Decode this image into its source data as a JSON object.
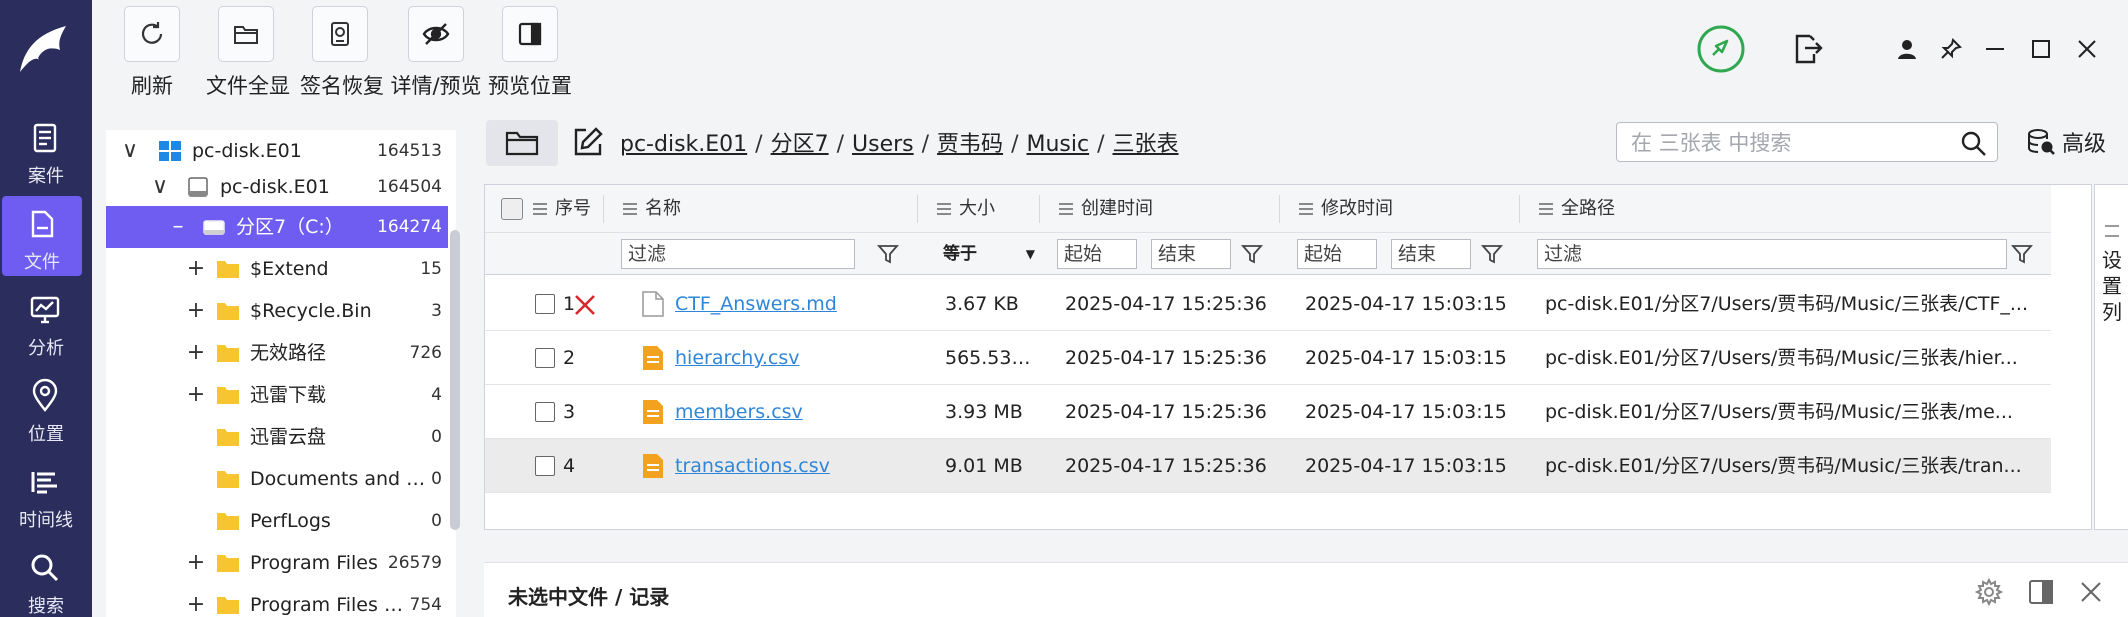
{
  "nav": {
    "items": [
      {
        "label": "案件",
        "icon": "case-icon"
      },
      {
        "label": "文件",
        "icon": "file-icon"
      },
      {
        "label": "分析",
        "icon": "analysis-icon"
      },
      {
        "label": "位置",
        "icon": "location-pin-icon"
      },
      {
        "label": "时间线",
        "icon": "timeline-icon"
      },
      {
        "label": "搜索",
        "icon": "search-icon"
      }
    ],
    "active_color": "#6f5cf0",
    "bg_color": "#2b2e5c"
  },
  "toolbar": {
    "buttons": [
      {
        "label": "刷新",
        "icon": "refresh-icon"
      },
      {
        "label": "文件全显",
        "icon": "folder-icon"
      },
      {
        "label": "签名恢复",
        "icon": "disk-restore-icon"
      },
      {
        "label": "详情/预览",
        "icon": "eye-off-icon"
      },
      {
        "label": "预览位置",
        "icon": "panel-right-icon"
      }
    ]
  },
  "tree": {
    "rows": [
      {
        "expander": "∨",
        "name": "pc-disk.E01",
        "count": "164513",
        "icon": "windows-icon"
      },
      {
        "expander": "∨",
        "name": "pc-disk.E01",
        "count": "164504",
        "icon": "disk-icon"
      },
      {
        "expander": "–",
        "name": "分区7（C:）",
        "count": "164274",
        "icon": "drive-icon",
        "selected": true
      },
      {
        "expander": "+",
        "name": "$Extend",
        "count": "15",
        "icon": "folder-icon"
      },
      {
        "expander": "+",
        "name": "$Recycle.Bin",
        "count": "3",
        "icon": "folder-icon"
      },
      {
        "expander": "+",
        "name": "无效路径",
        "count": "726",
        "icon": "folder-icon"
      },
      {
        "expander": "+",
        "name": "迅雷下载",
        "count": "4",
        "icon": "folder-icon"
      },
      {
        "expander": "",
        "name": "迅雷云盘",
        "count": "0",
        "icon": "folder-icon"
      },
      {
        "expander": "",
        "name": "Documents and S...",
        "count": "0",
        "icon": "folder-icon"
      },
      {
        "expander": "",
        "name": "PerfLogs",
        "count": "0",
        "icon": "folder-icon"
      },
      {
        "expander": "+",
        "name": "Program Files",
        "count": "26579",
        "icon": "folder-icon"
      },
      {
        "expander": "+",
        "name": "Program Files (...",
        "count": "754",
        "icon": "folder-icon"
      }
    ]
  },
  "path": {
    "segments": [
      "pc-disk.E01",
      "分区7",
      "Users",
      "贾韦码",
      "Music",
      "三张表"
    ],
    "separator": "/"
  },
  "search": {
    "placeholder": "在 三张表 中搜索"
  },
  "advanced": {
    "label": "高级"
  },
  "table": {
    "headers": {
      "index": "序号",
      "name": "名称",
      "size": "大小",
      "created": "创建时间",
      "modified": "修改时间",
      "fullpath": "全路径"
    },
    "filters": {
      "name_placeholder": "过滤",
      "size_select": "等于",
      "created_start": "起始",
      "created_end": "结束",
      "modified_start": "起始",
      "modified_end": "结束",
      "path_placeholder": "过滤"
    },
    "rows": [
      {
        "index": "1",
        "name": "CTF_Answers.md",
        "size": "3.67 KB",
        "created": "2025-04-17 15:25:36",
        "modified": "2025-04-17 15:03:15",
        "path": "pc-disk.E01/分区7/Users/贾韦码/Music/三张表/CTF_...",
        "icon": "text-file-icon",
        "deleted": true
      },
      {
        "index": "2",
        "name": "hierarchy.csv",
        "size": "565.53 ...",
        "created": "2025-04-17 15:25:36",
        "modified": "2025-04-17 15:03:15",
        "path": "pc-disk.E01/分区7/Users/贾韦码/Music/三张表/hier...",
        "icon": "csv-file-icon"
      },
      {
        "index": "3",
        "name": "members.csv",
        "size": "3.93 MB",
        "created": "2025-04-17 15:25:36",
        "modified": "2025-04-17 15:03:15",
        "path": "pc-disk.E01/分区7/Users/贾韦码/Music/三张表/me...",
        "icon": "csv-file-icon"
      },
      {
        "index": "4",
        "name": "transactions.csv",
        "size": "9.01 MB",
        "created": "2025-04-17 15:25:36",
        "modified": "2025-04-17 15:03:15",
        "path": "pc-disk.E01/分区7/Users/贾韦码/Music/三张表/tran...",
        "icon": "csv-file-icon",
        "highlighted": true
      }
    ]
  },
  "column_settings": {
    "label": "设置列"
  },
  "bottom": {
    "title": "未选中文件 / 记录"
  },
  "colors": {
    "link": "#2f86d8",
    "csv_icon": "#f3a21f",
    "status_green": "#2fa84f",
    "deleted_red": "#d9262c"
  }
}
